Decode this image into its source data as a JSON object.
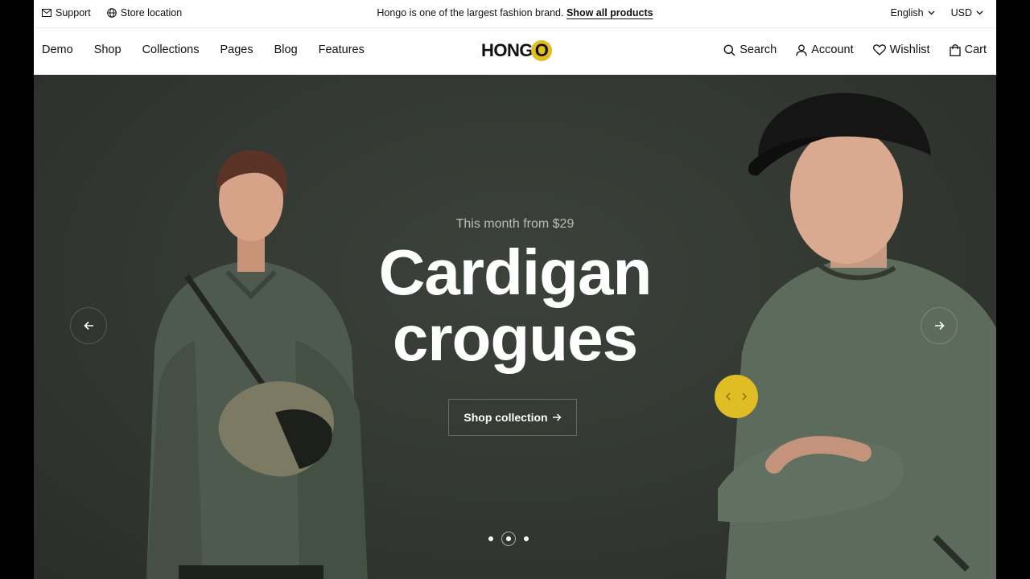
{
  "topbar": {
    "support_label": "Support",
    "store_label": "Store location",
    "announcement_text": "Hongo is one of the largest fashion brand.",
    "announcement_link": "Show all products",
    "language": "English",
    "currency": "USD"
  },
  "nav": {
    "items": [
      {
        "label": "Demo"
      },
      {
        "label": "Shop"
      },
      {
        "label": "Collections"
      },
      {
        "label": "Pages"
      },
      {
        "label": "Blog"
      },
      {
        "label": "Features"
      }
    ],
    "logo_text": "HONG",
    "logo_o": "O",
    "search_label": "Search",
    "account_label": "Account",
    "wishlist_label": "Wishlist",
    "cart_label": "Cart"
  },
  "hero": {
    "kicker": "This month from $29",
    "headline_line1": "Cardigan",
    "headline_line2": "crogues",
    "cta_label": "Shop collection",
    "slides_total": 3,
    "slide_active": 2
  },
  "colors": {
    "accent": "#e1bd25",
    "hero_bg": "#343a33",
    "sweater": "#5c6a5c"
  },
  "icons": [
    "mail-icon",
    "globe-icon",
    "chevron-down-icon",
    "search-icon",
    "user-icon",
    "heart-icon",
    "bag-icon",
    "arrow-left-icon",
    "arrow-right-icon"
  ]
}
